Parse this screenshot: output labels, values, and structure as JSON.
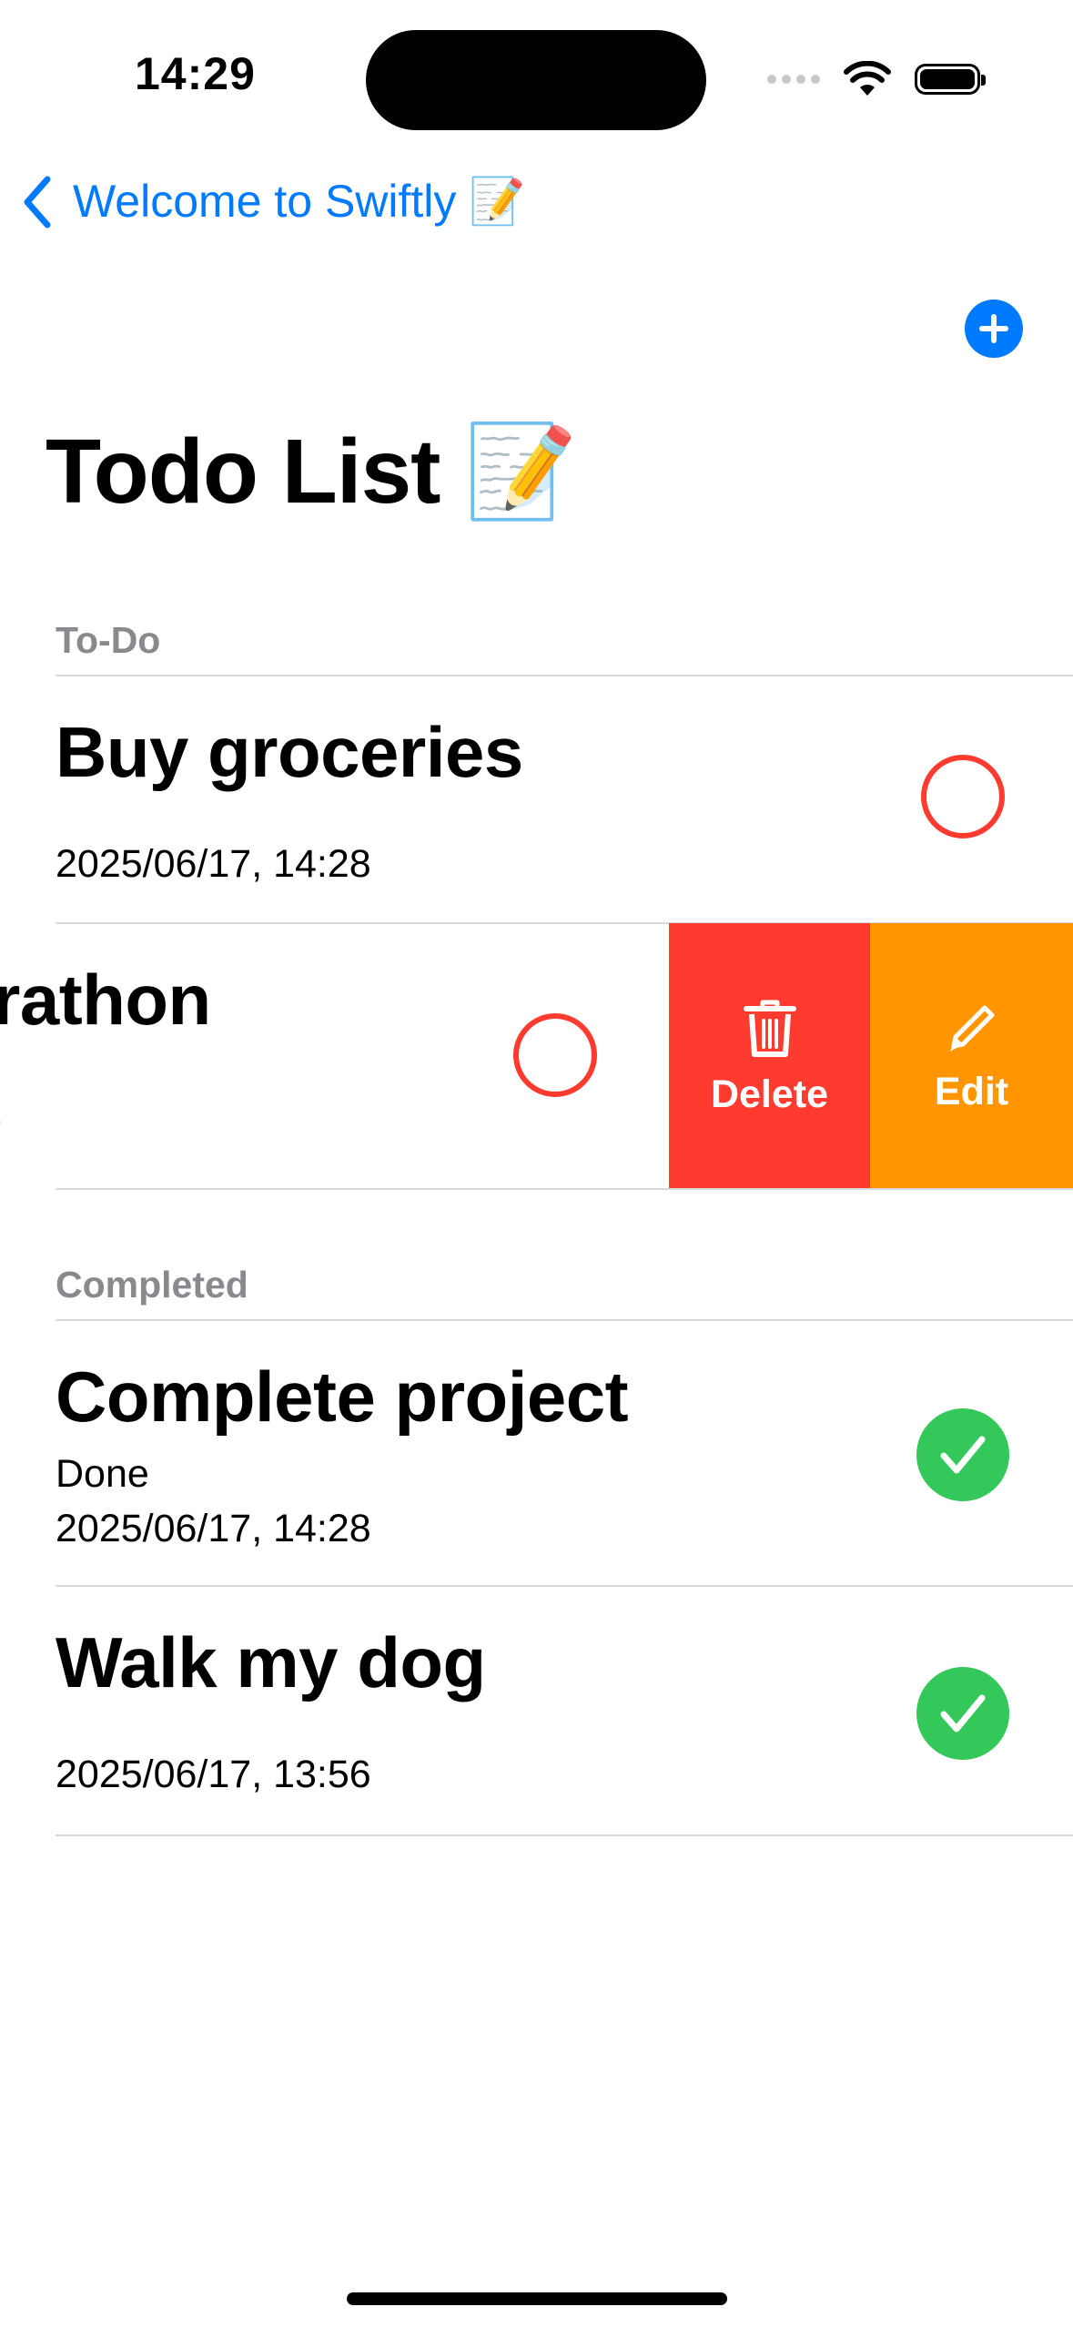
{
  "status_bar": {
    "time": "14:29"
  },
  "nav": {
    "back_label": "Welcome to Swiftly 📝"
  },
  "page": {
    "title": "Todo List 📝"
  },
  "sections": {
    "todo_header": "To-Do",
    "completed_header": "Completed"
  },
  "todo_items": [
    {
      "title": "Buy groceries",
      "note": "",
      "date": "2025/06/17, 14:28",
      "status": "open"
    },
    {
      "title": "rathon",
      "note": "",
      "date": ",",
      "status": "open",
      "swiped": true
    }
  ],
  "completed_items": [
    {
      "title": "Complete project",
      "note": "Done",
      "date": "2025/06/17, 14:28",
      "status": "done"
    },
    {
      "title": "Walk my dog",
      "note": "",
      "date": "2025/06/17, 13:56",
      "status": "done"
    }
  ],
  "swipe_actions": {
    "delete_label": "Delete",
    "edit_label": "Edit",
    "delete_color": "#ff3b30",
    "edit_color": "#ff9500"
  },
  "icons": {
    "back": "chevron-left-icon",
    "add": "plus-circle-icon",
    "delete": "trash-icon",
    "edit": "pencil-icon",
    "done": "checkmark-icon"
  }
}
